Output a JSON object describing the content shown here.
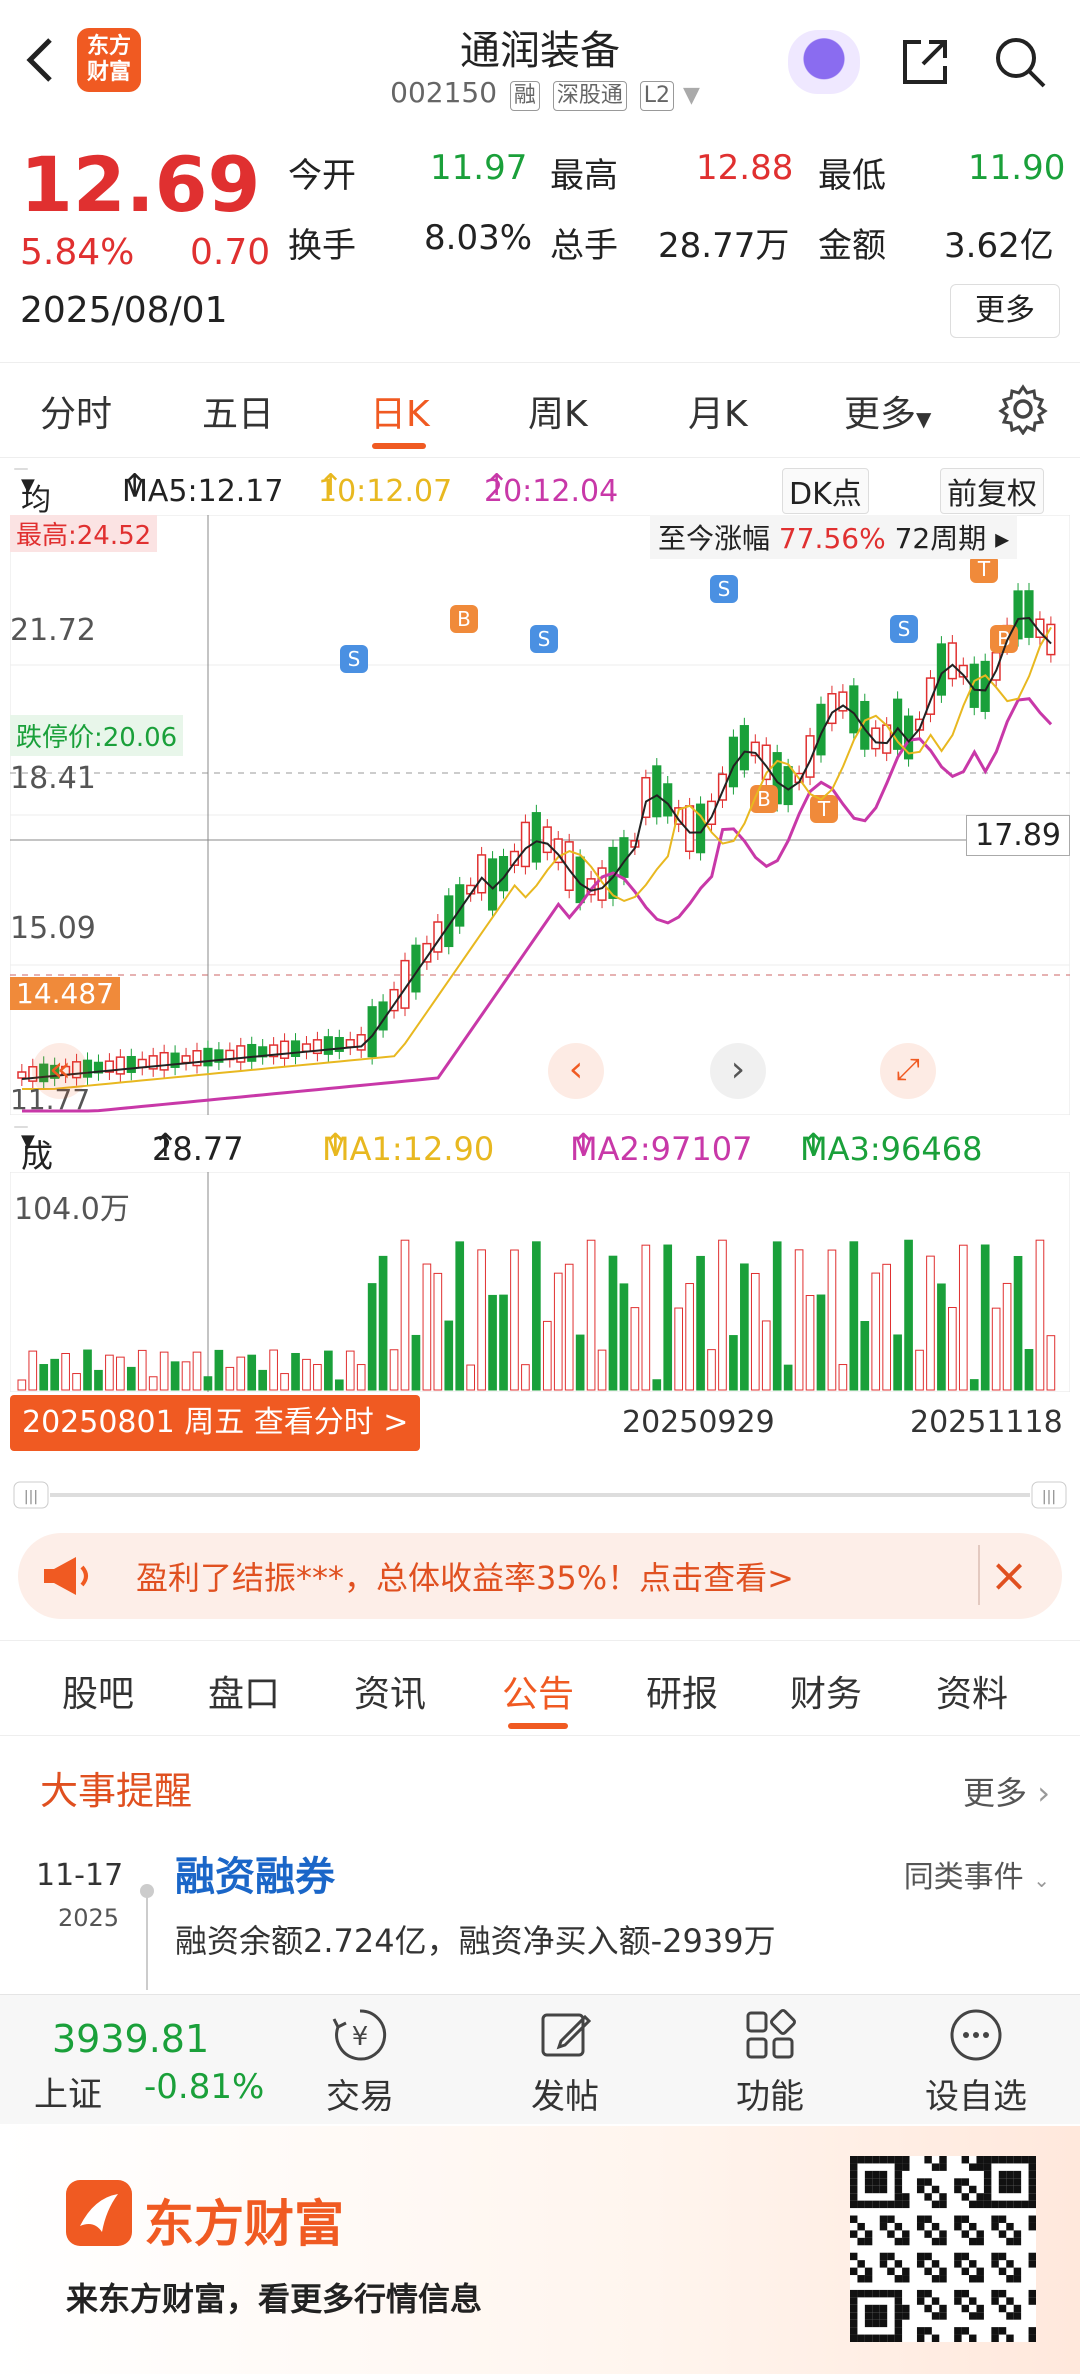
{
  "header": {
    "back_icon": "chevron-left-icon",
    "logo_text": "东方\n财富",
    "stock_name": "通润装备",
    "stock_code": "002150",
    "tags": [
      "融",
      "深股通",
      "L2"
    ]
  },
  "quote": {
    "price": "12.69",
    "change_pct": "5.84%",
    "change_amt": "0.70",
    "date": "2025/08/01",
    "open_label": "今开",
    "open": "11.97",
    "high_label": "最高",
    "high": "12.88",
    "low_label": "最低",
    "low": "11.90",
    "turnover_label": "换手",
    "turnover": "8.03%",
    "volume_label": "总手",
    "volume": "28.77万",
    "amount_label": "金额",
    "amount": "3.62亿",
    "more": "更多"
  },
  "period_tabs": [
    "分时",
    "五日",
    "日K",
    "周K",
    "月K",
    "更多"
  ],
  "active_period": "日K",
  "ma": {
    "type": "均线",
    "ma5": "MA5:12.17",
    "ma10": "10:12.07",
    "ma20": "20:12.04",
    "dk": "DK点",
    "fq": "前复权"
  },
  "kchart": {
    "top_label": "最高:24.52",
    "range_label": "至今涨幅",
    "range_value": "77.56%",
    "range_period": "72周期",
    "limit_down_label": "跌停价:20.06",
    "price_ticks": [
      "21.72",
      "18.41",
      "15.09"
    ],
    "current_price_tag": "17.89",
    "cross_price": "14.487",
    "low_label": "11.77",
    "signals": [
      "S",
      "B",
      "T"
    ]
  },
  "volume": {
    "label": "成交量",
    "value": "28.77万",
    "ma1": "MA1:12.90万",
    "ma2": "MA2:97107",
    "ma3": "MA3:96468",
    "max_tick": "104.0万"
  },
  "date_bar": {
    "button": "20250801 周五 查看分时 >",
    "date_mid": "20250929",
    "date_right": "20251118"
  },
  "promo": {
    "text": "盈利了结振***，总体收益率35%！点击查看>"
  },
  "news_tabs": [
    "股吧",
    "盘口",
    "资讯",
    "公告",
    "研报",
    "财务",
    "资料"
  ],
  "active_news_tab": "公告",
  "events": {
    "title": "大事提醒",
    "more": "更多",
    "date": "11-17",
    "year": "2025",
    "event_title": "融资融券",
    "event_type": "同类事件",
    "event_desc": "融资余额2.724亿，融资净买入额-2939万"
  },
  "bottom_nav": {
    "index_value": "3939.81",
    "index_name": "上证",
    "index_pct": "-0.81%",
    "items": [
      "交易",
      "发帖",
      "功能",
      "设自选"
    ]
  },
  "footer": {
    "brand": "东方财富",
    "slogan": "来东方财富，看更多行情信息"
  },
  "colors": {
    "up": "#e03030",
    "down": "#1aa03a",
    "accent": "#f05a22",
    "ma5": "#222222",
    "ma10": "#e8b820",
    "ma20": "#c838a8"
  }
}
